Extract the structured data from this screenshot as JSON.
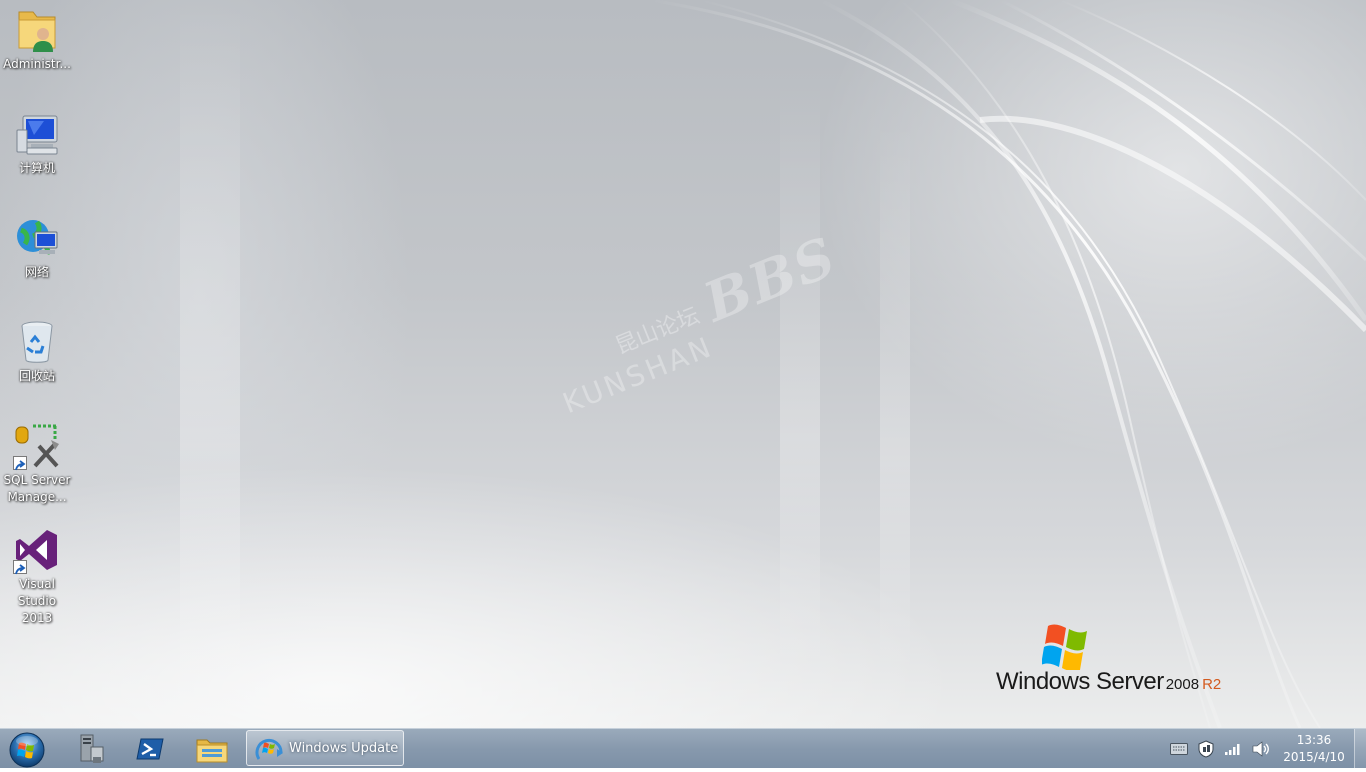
{
  "desktop": {
    "icons": [
      {
        "label": "Administr...",
        "icon": "user-folder-icon"
      },
      {
        "label": "计算机",
        "icon": "computer-icon"
      },
      {
        "label": "网络",
        "icon": "network-icon"
      },
      {
        "label": "回收站",
        "icon": "recycle-bin-icon"
      },
      {
        "label_line1": "SQL Server",
        "label_line2": "Manage...",
        "icon": "sql-server-management-icon",
        "shortcut": true
      },
      {
        "label_line1": "Visual",
        "label_line2": "Studio 2013",
        "icon": "visual-studio-icon",
        "shortcut": true
      }
    ],
    "watermark": {
      "cn": "昆山论坛",
      "en": "KUNSHAN",
      "bbs": "BBS"
    },
    "branding": {
      "main": "Windows Server",
      "year": "2008",
      "edition": "R2"
    }
  },
  "taskbar": {
    "start_icon": "windows-start-orb-icon",
    "pinned": [
      {
        "icon": "server-manager-icon"
      },
      {
        "icon": "powershell-icon"
      },
      {
        "icon": "windows-explorer-icon"
      }
    ],
    "active_task": {
      "label": "Windows Update",
      "icon": "windows-update-icon"
    },
    "tray": {
      "icons": [
        "keyboard-icon",
        "action-center-icon",
        "network-signal-icon",
        "volume-icon"
      ]
    },
    "clock": {
      "time": "13:36",
      "date": "2015/4/10"
    }
  },
  "colors": {
    "taskbar": "#8799ad",
    "edition_accent": "#d35a1f",
    "vs_purple": "#68217a"
  }
}
